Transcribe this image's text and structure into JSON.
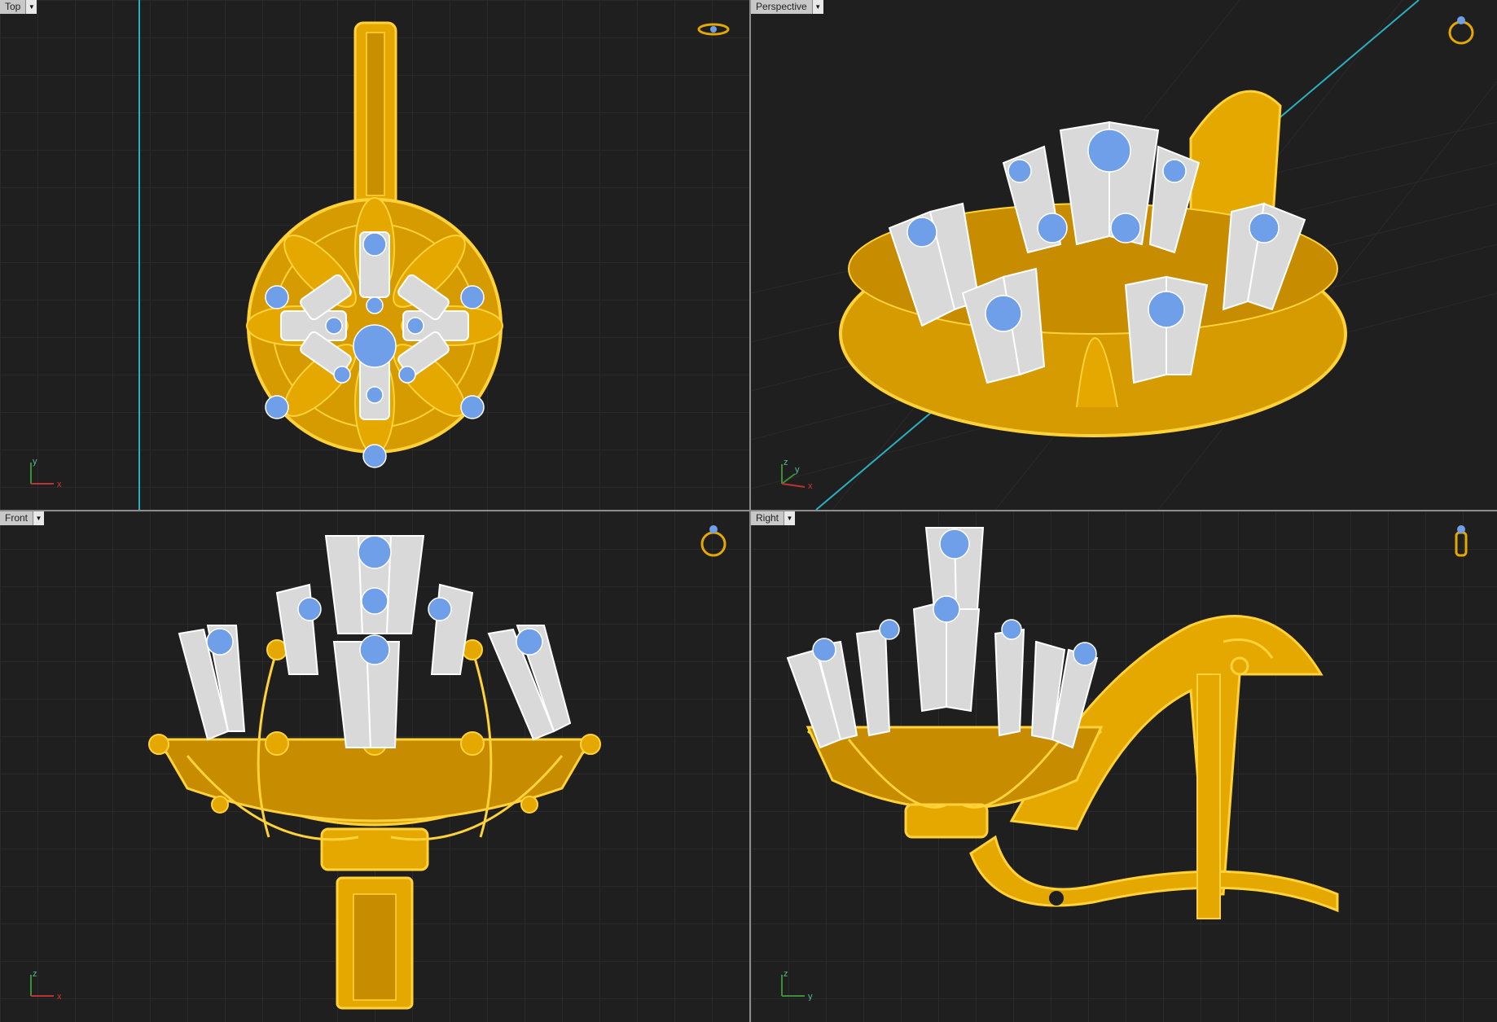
{
  "viewports": {
    "top": {
      "label": "Top",
      "axis_a": "y",
      "axis_b": "x"
    },
    "perspective": {
      "label": "Perspective",
      "axis_a": "z",
      "axis_b": "y",
      "axis_c": "x"
    },
    "front": {
      "label": "Front",
      "axis_a": "z",
      "axis_b": "x"
    },
    "right": {
      "label": "Right",
      "axis_a": "z",
      "axis_b": "y"
    }
  },
  "colors": {
    "gold": "#e5a800",
    "gold_edge": "#ffd23a",
    "silver": "#d9d9d9",
    "gem": "#6f9fe8",
    "axis_line": "#2ab0c0",
    "viewport_bg": "#1f1f1f"
  },
  "icons": {
    "top": "ring-top-view-icon",
    "perspective": "ring-perspective-icon",
    "front": "ring-front-view-icon",
    "right": "ring-side-view-icon",
    "menu": "dropdown-arrow-icon"
  }
}
